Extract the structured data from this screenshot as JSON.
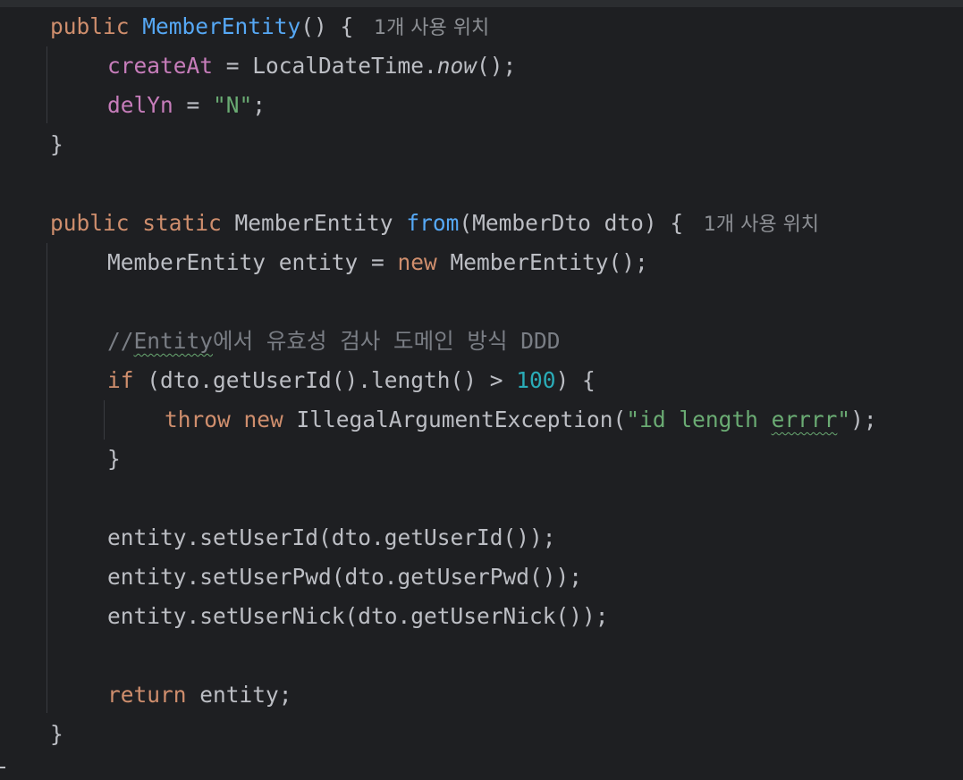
{
  "editor": {
    "usage_hint": "1개 사용 위치",
    "constructor": {
      "kw_public": "public",
      "name": "MemberEntity",
      "sig_tail": "() {",
      "line_createAt_field": "createAt",
      "line_createAt_mid": " = LocalDateTime.",
      "line_createAt_call": "now",
      "line_createAt_end": "();",
      "line_delYn_field": "delYn",
      "line_delYn_mid": " = ",
      "line_delYn_str": "\"N\"",
      "line_delYn_end": ";",
      "close": "}"
    },
    "from_method": {
      "kw_public": "public",
      "kw_static": "static",
      "return_type": " MemberEntity ",
      "name": "from",
      "params": "(MemberDto dto) {",
      "entity_decl": "MemberEntity entity = ",
      "kw_new": "new",
      "entity_ctor": " MemberEntity();",
      "comment_prefix": "//",
      "comment_word": "Entity",
      "comment_rest": "에서 유효성 검사 도메인 방식 DDD",
      "kw_if": "if",
      "if_cond": " (dto.getUserId().length() > ",
      "if_num": "100",
      "if_tail": ") {",
      "kw_throw": "throw",
      "kw_new2": "new",
      "exc_class": " IllegalArgumentException(",
      "exc_str_a": "\"id length ",
      "exc_str_b": "errrr",
      "exc_str_c": "\"",
      "exc_end": ");",
      "if_close": "}",
      "set_id": "entity.setUserId(dto.getUserId());",
      "set_pwd": "entity.setUserPwd(dto.getUserPwd());",
      "set_nick": "entity.setUserNick(dto.getUserNick());",
      "kw_return": "return",
      "return_tail": " entity;",
      "close": "}"
    }
  },
  "colors": {
    "background": "#1e1f22",
    "keyword": "#cf8e6d",
    "method": "#56a8f5",
    "field": "#c77dbb",
    "string": "#6aab73",
    "number": "#2aacb8",
    "comment": "#7a7e85",
    "plain": "#bcbec4",
    "hint": "#8c8f94"
  }
}
